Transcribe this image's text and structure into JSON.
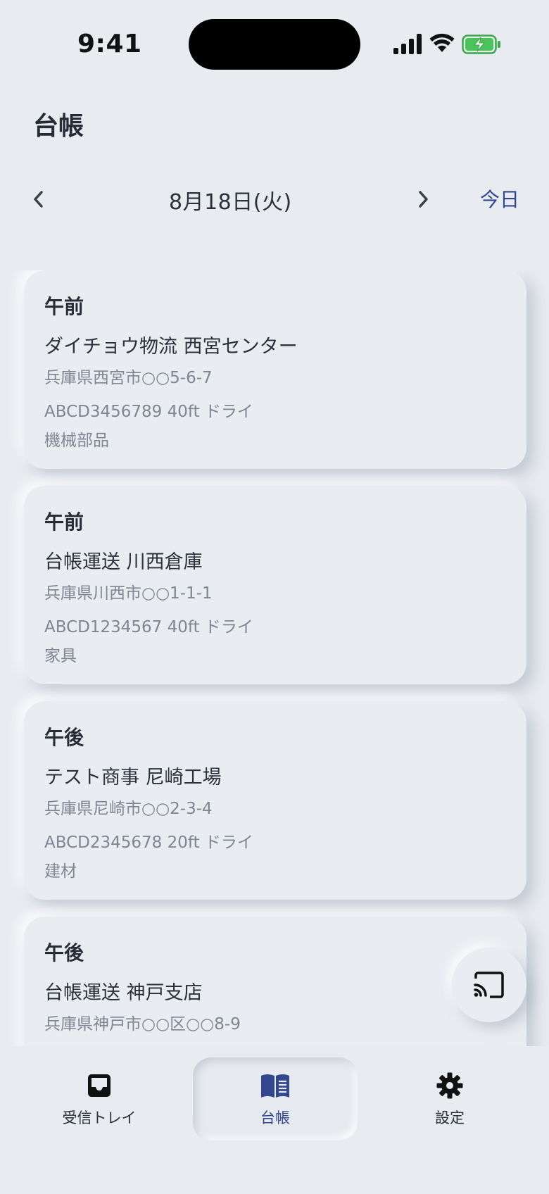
{
  "status_bar": {
    "time": "9:41"
  },
  "header": {
    "title": "台帳"
  },
  "date_nav": {
    "date": "8月18日(火)",
    "today_label": "今日"
  },
  "cards": [
    {
      "period": "午前",
      "name": "ダイチョウ物流 西宮センター",
      "address": "兵庫県西宮市○○5-6-7",
      "container": "ABCD3456789 40ft ドライ",
      "cargo": "機械部品"
    },
    {
      "period": "午前",
      "name": "台帳運送 川西倉庫",
      "address": "兵庫県川西市○○1-1-1",
      "container": "ABCD1234567 40ft ドライ",
      "cargo": "家具"
    },
    {
      "period": "午後",
      "name": "テスト商事 尼崎工場",
      "address": "兵庫県尼崎市○○2-3-4",
      "container": "ABCD2345678 20ft ドライ",
      "cargo": "建材"
    },
    {
      "period": "午後",
      "name": "台帳運送 神戸支店",
      "address": "兵庫県神戸市○○区○○8-9",
      "container": "",
      "cargo": ""
    }
  ],
  "tabs": [
    {
      "label": "受信トレイ",
      "icon": "inbox-icon"
    },
    {
      "label": "台帳",
      "icon": "book-icon"
    },
    {
      "label": "設定",
      "icon": "gear-icon"
    }
  ],
  "colors": {
    "background": "#e8ebf0",
    "accent": "#33478f",
    "text": "#262b36",
    "muted": "#7f8592"
  }
}
